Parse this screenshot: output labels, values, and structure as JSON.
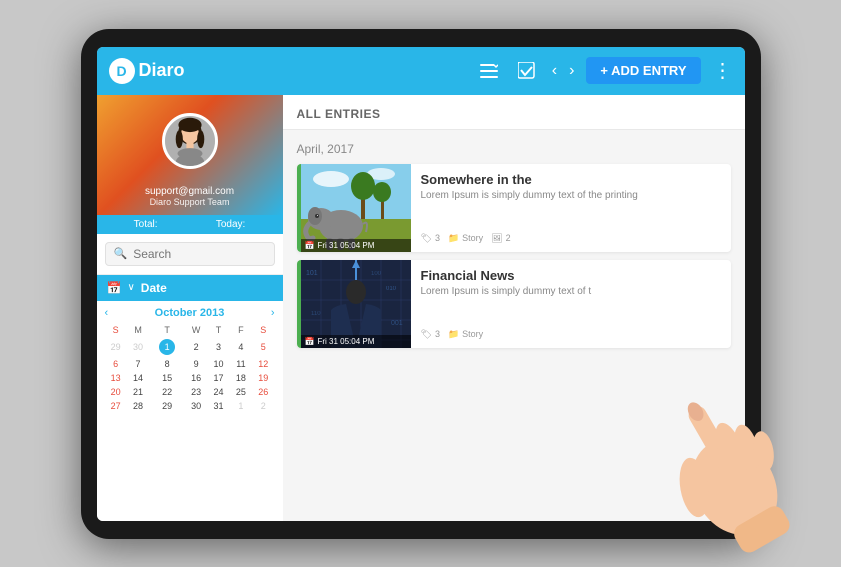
{
  "app": {
    "name": "Diaro",
    "logo_letter": "D"
  },
  "toolbar": {
    "add_entry_label": "+ ADD ENTRY",
    "nav_back": "‹",
    "nav_forward": "›"
  },
  "sidebar": {
    "email": "support@gmail.com",
    "team": "Diaro Support Team",
    "stats": {
      "total_label": "Total:",
      "today_label": "Today:"
    },
    "search_placeholder": "Search",
    "date_section_label": "Date",
    "calendar": {
      "month": "October 2013",
      "days_header": [
        "S",
        "M",
        "T",
        "W",
        "T",
        "F",
        "S"
      ],
      "weeks": [
        [
          "29",
          "30",
          "1",
          "2",
          "3",
          "4",
          "5"
        ],
        [
          "6",
          "7",
          "8",
          "9",
          "10",
          "11",
          "12"
        ],
        [
          "13",
          "14",
          "15",
          "16",
          "17",
          "18",
          "19"
        ],
        [
          "20",
          "21",
          "22",
          "23",
          "24",
          "25",
          "26"
        ],
        [
          "27",
          "28",
          "29",
          "30",
          "31",
          "1",
          "2"
        ]
      ],
      "today_day": "1"
    }
  },
  "content": {
    "header": "ALL ENTRIES",
    "section_date": "April, 2017",
    "entries": [
      {
        "title": "Somewhere in the",
        "excerpt": "Lorem Ipsum is simply dummy text of the printing",
        "date_badge": "Fri 31  05:04 PM",
        "tags": "3",
        "category": "Story",
        "images": "2",
        "accent_color": "#4CAF50"
      },
      {
        "title": "Financial News",
        "excerpt": "Lorem Ipsum is simply dummy text of t",
        "date_badge": "Fri 31  05:04 PM",
        "tags": "3",
        "category": "Story",
        "images": "",
        "accent_color": "#4CAF50"
      }
    ]
  },
  "icons": {
    "menu": "≡",
    "check": "✓",
    "more": "⋮",
    "search": "🔍",
    "calendar": "📅",
    "tag": "🏷",
    "folder": "📁",
    "image": "🖼",
    "clock": "🕐",
    "chevron_left": "‹",
    "chevron_right": "›",
    "chevron_down": "∨"
  }
}
